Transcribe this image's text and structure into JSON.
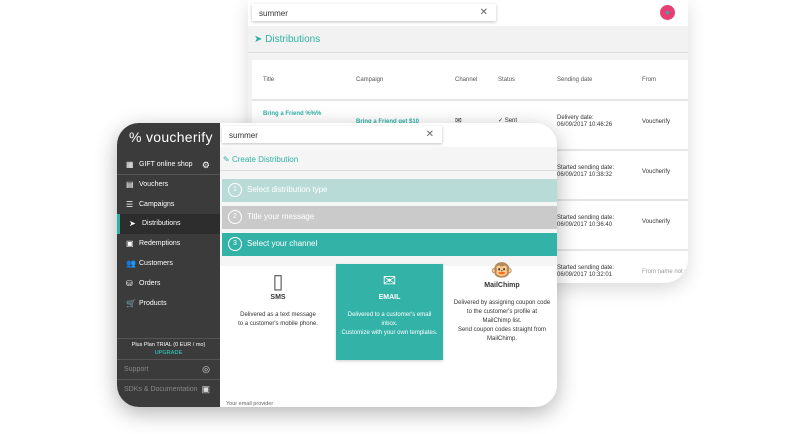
{
  "back": {
    "search": "summer",
    "title": "Distributions",
    "columns": [
      "Title",
      "Campaign",
      "Channel",
      "Status",
      "Sending date",
      "From"
    ],
    "rows": [
      {
        "title": "Bring a Friend %%%",
        "campaign": "Bring a Friend get $10",
        "status": "✓ Sent",
        "date_label": "Delivery date:",
        "date": "06/09/2017 10:46:26",
        "from": "Voucherify"
      },
      {
        "date_label": "Started sending date:",
        "date": "06/09/2017 10:38:32",
        "from": "Voucherify"
      },
      {
        "date_label": "Started sending date:",
        "date": "06/09/2017 10:36:40",
        "from": "Voucherify"
      },
      {
        "date_label": "Started sending date:",
        "date": "06/09/2017 10:32:01",
        "from": "From name not d"
      }
    ]
  },
  "front": {
    "logo": "% voucherify",
    "search": "summer",
    "shop": "GIFT online shop",
    "nav": [
      "Vouchers",
      "Campaigns",
      "Distributions",
      "Redemptions",
      "Customers",
      "Orders",
      "Products"
    ],
    "plan": "Plus Plan TRIAL (0 EUR / mo)",
    "upgrade": "UPGRADE",
    "support": "Support",
    "sdks": "SDKs & Documentation",
    "header": "Create Distribution",
    "steps": [
      {
        "n": "1",
        "label": "Select distribution type"
      },
      {
        "n": "2",
        "label": "Title your message"
      },
      {
        "n": "3",
        "label": "Select your channel"
      }
    ],
    "cards": [
      {
        "title": "SMS",
        "lines": [
          "Delivered as a text message",
          "to a customer's mobile phone."
        ]
      },
      {
        "title": "EMAIL",
        "lines": [
          "Delivered to a customer's email",
          "inbox.",
          "Customize with your own templates."
        ]
      },
      {
        "title": "MailChimp",
        "lines": [
          "Delivered by assigning coupon code",
          "to the customer's profile at",
          "MailChimp list.",
          "Send coupon codes straight from",
          "MailChimp."
        ]
      }
    ],
    "provider": "Your email provider"
  },
  "colors": {
    "accent": "#2fb0a4",
    "sidebar": "#3b3b3b"
  }
}
